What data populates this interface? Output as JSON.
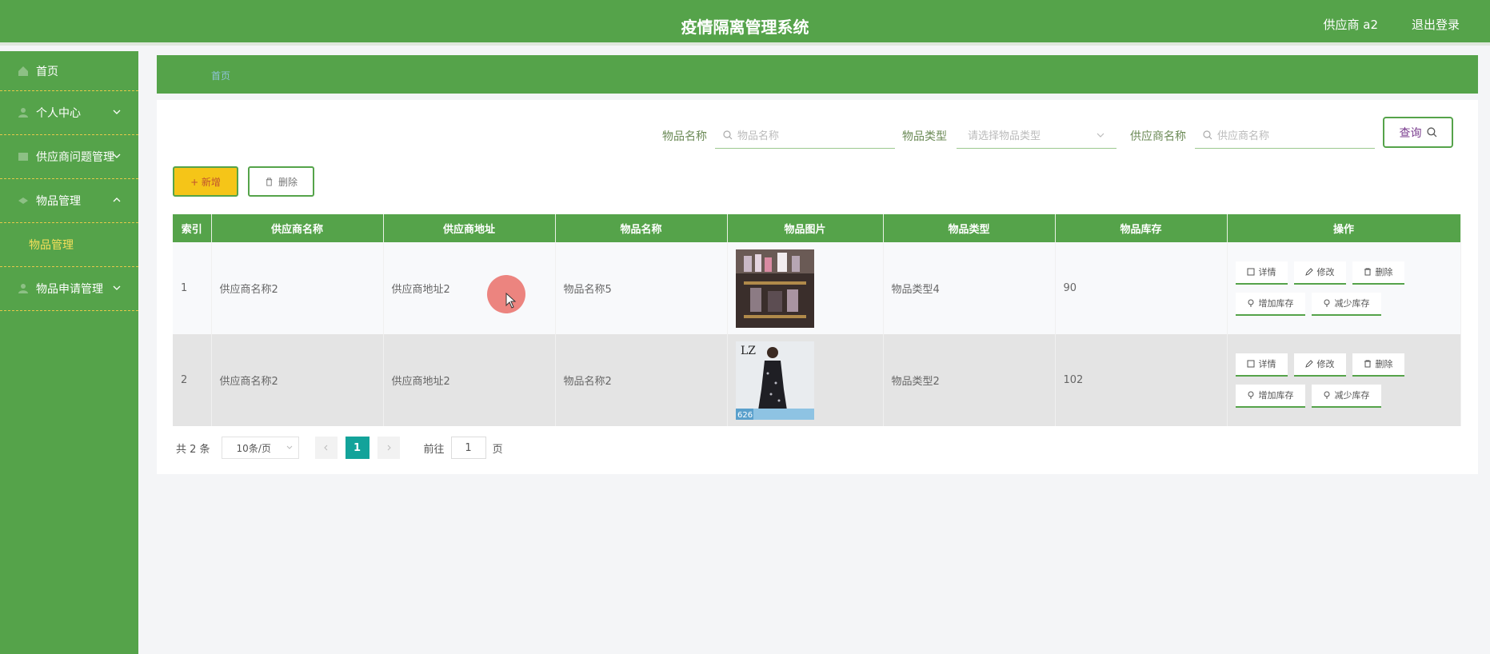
{
  "header": {
    "title": "疫情隔离管理系统",
    "user_label": "供应商 a2",
    "logout_label": "退出登录"
  },
  "sidebar": {
    "items": [
      {
        "label": "首页",
        "icon": "home-icon"
      },
      {
        "label": "个人中心",
        "icon": "user-icon"
      },
      {
        "label": "供应商问题管理",
        "icon": "question-icon"
      },
      {
        "label": "物品管理",
        "icon": "box-icon"
      },
      {
        "label": "物品管理",
        "icon": ""
      },
      {
        "label": "物品申请管理",
        "icon": "apply-icon"
      }
    ]
  },
  "breadcrumb": {
    "label": "首页"
  },
  "search": {
    "name_label": "物品名称",
    "name_placeholder": "物品名称",
    "type_label": "物品类型",
    "type_placeholder": "请选择物品类型",
    "supplier_label": "供应商名称",
    "supplier_placeholder": "供应商名称",
    "query_label": "查询"
  },
  "actions": {
    "add_label": "+ 新增",
    "delete_label": "删除"
  },
  "table": {
    "headers": [
      "索引",
      "供应商名称",
      "供应商地址",
      "物品名称",
      "物品图片",
      "物品类型",
      "物品库存",
      "操作"
    ],
    "rows": [
      {
        "index": "1",
        "supplier": "供应商名称2",
        "address": "供应商地址2",
        "item": "物品名称5",
        "type": "物品类型4",
        "stock": "90"
      },
      {
        "index": "2",
        "supplier": "供应商名称2",
        "address": "供应商地址2",
        "item": "物品名称2",
        "type": "物品类型2",
        "stock": "102"
      }
    ],
    "ops": {
      "detail": "详情",
      "edit": "修改",
      "delete": "删除",
      "add_stock": "增加库存",
      "reduce_stock": "减少库存"
    }
  },
  "pagination": {
    "total": "共 2 条",
    "page_size": "10条/页",
    "current_page": "1",
    "goto_label": "前往",
    "goto_value": "1",
    "page_suffix": "页"
  },
  "thumb2_text": {
    "top": "LZ",
    "badge": "626"
  },
  "colors": {
    "primary": "#55a34a",
    "accent_yellow": "#f5c518",
    "page_active": "#13a39a"
  }
}
